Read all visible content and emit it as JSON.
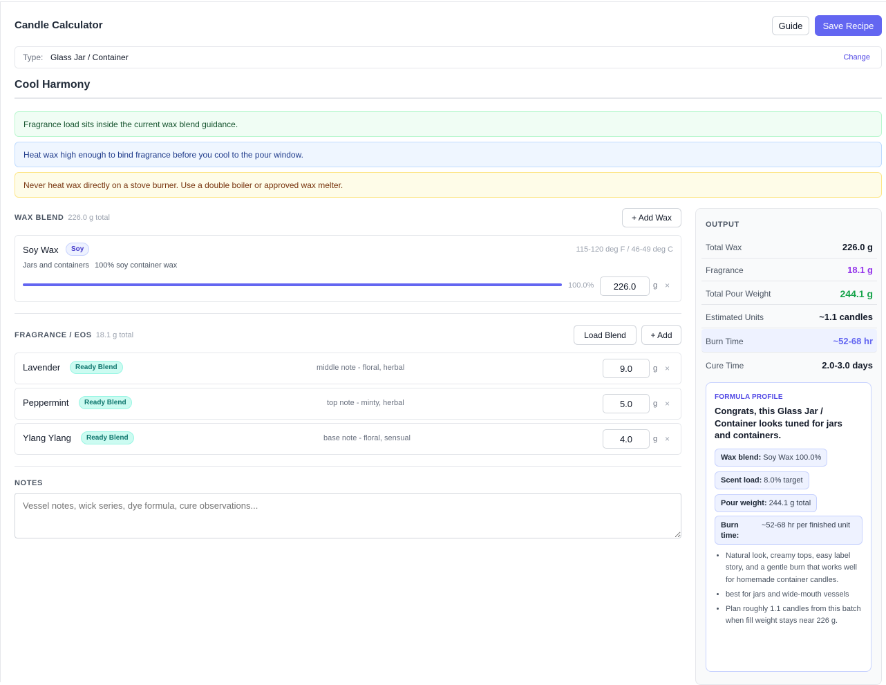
{
  "header": {
    "app_title": "Candle Calculator",
    "guide_label": "Guide",
    "save_label": "Save Recipe"
  },
  "type_bar": {
    "label": "Type:",
    "value": "Glass Jar / Container",
    "change_label": "Change"
  },
  "recipe_name": "Cool Harmony",
  "alerts": [
    {
      "kind": "success",
      "text": "Fragrance load sits inside the current wax blend guidance."
    },
    {
      "kind": "info",
      "text": "Heat wax high enough to bind fragrance before you cool to the pour window."
    },
    {
      "kind": "warning",
      "text": "Never heat wax directly on a stove burner. Use a double boiler or approved wax melter."
    }
  ],
  "wax_blend": {
    "heading": "WAX BLEND",
    "total": "226.0 g total",
    "add_label": "+ Add Wax",
    "items": [
      {
        "name": "Soy Wax",
        "badge": "Soy",
        "temp": "115-120 deg F / 46-49 deg C",
        "use": "Jars and containers",
        "detail": "100% soy container wax",
        "percent_label": "100.0%",
        "percent": 100,
        "grams": "226.0",
        "unit": "g",
        "remove": "×"
      }
    ]
  },
  "fragrance": {
    "heading": "FRAGRANCE / EOS",
    "total": "18.1 g total",
    "load_label": "Load Blend",
    "add_label": "+ Add",
    "items": [
      {
        "name": "Lavender",
        "badge": "Ready Blend",
        "note": "middle note - floral, herbal",
        "grams": "9.0",
        "unit": "g",
        "remove": "×"
      },
      {
        "name": "Peppermint",
        "badge": "Ready Blend",
        "note": "top note - minty, herbal",
        "grams": "5.0",
        "unit": "g",
        "remove": "×"
      },
      {
        "name": "Ylang Ylang",
        "badge": "Ready Blend",
        "note": "base note - floral, sensual",
        "grams": "4.0",
        "unit": "g",
        "remove": "×"
      }
    ]
  },
  "notes": {
    "heading": "NOTES",
    "placeholder": "Vessel notes, wick series, dye formula, cure observations..."
  },
  "output": {
    "heading": "OUTPUT",
    "rows": [
      {
        "label": "Total Wax",
        "value": "226.0 g",
        "color": "#111827"
      },
      {
        "label": "Fragrance",
        "value": "18.1 g",
        "color": "#9333ea"
      },
      {
        "label": "Total Pour Weight",
        "value": "244.1 g",
        "color": "#16a34a"
      },
      {
        "label": "Estimated Units",
        "value": "~1.1 candles",
        "color": "#111827"
      },
      {
        "label": "Burn Time",
        "value": "~52-68 hr",
        "color": "#6366f1"
      },
      {
        "label": "Cure Time",
        "value": "2.0-3.0 days",
        "color": "#111827"
      }
    ]
  },
  "profile": {
    "tag": "FORMULA PROFILE",
    "title": "Congrats, this Glass Jar / Container looks tuned for jars and containers.",
    "chips": [
      {
        "key": "Wax blend:",
        "value": "Soy Wax 100.0%"
      },
      {
        "key": "Scent load:",
        "value": "8.0% target"
      },
      {
        "key": "Pour weight:",
        "value": "244.1 g total"
      },
      {
        "key": "Burn time:",
        "value": "~52-68 hr per finished unit"
      }
    ],
    "bullets": [
      "Natural look, creamy tops, easy label story, and a gentle burn that works well for homemade container candles.",
      "best for jars and wide-mouth vessels",
      "Plan roughly 1.1 candles from this batch when fill weight stays near 226 g."
    ]
  },
  "colors": {
    "accent": "#6366f1",
    "success_bg": "#f0fdf4",
    "info_bg": "#eff6ff",
    "warning_bg": "#fefce8"
  }
}
